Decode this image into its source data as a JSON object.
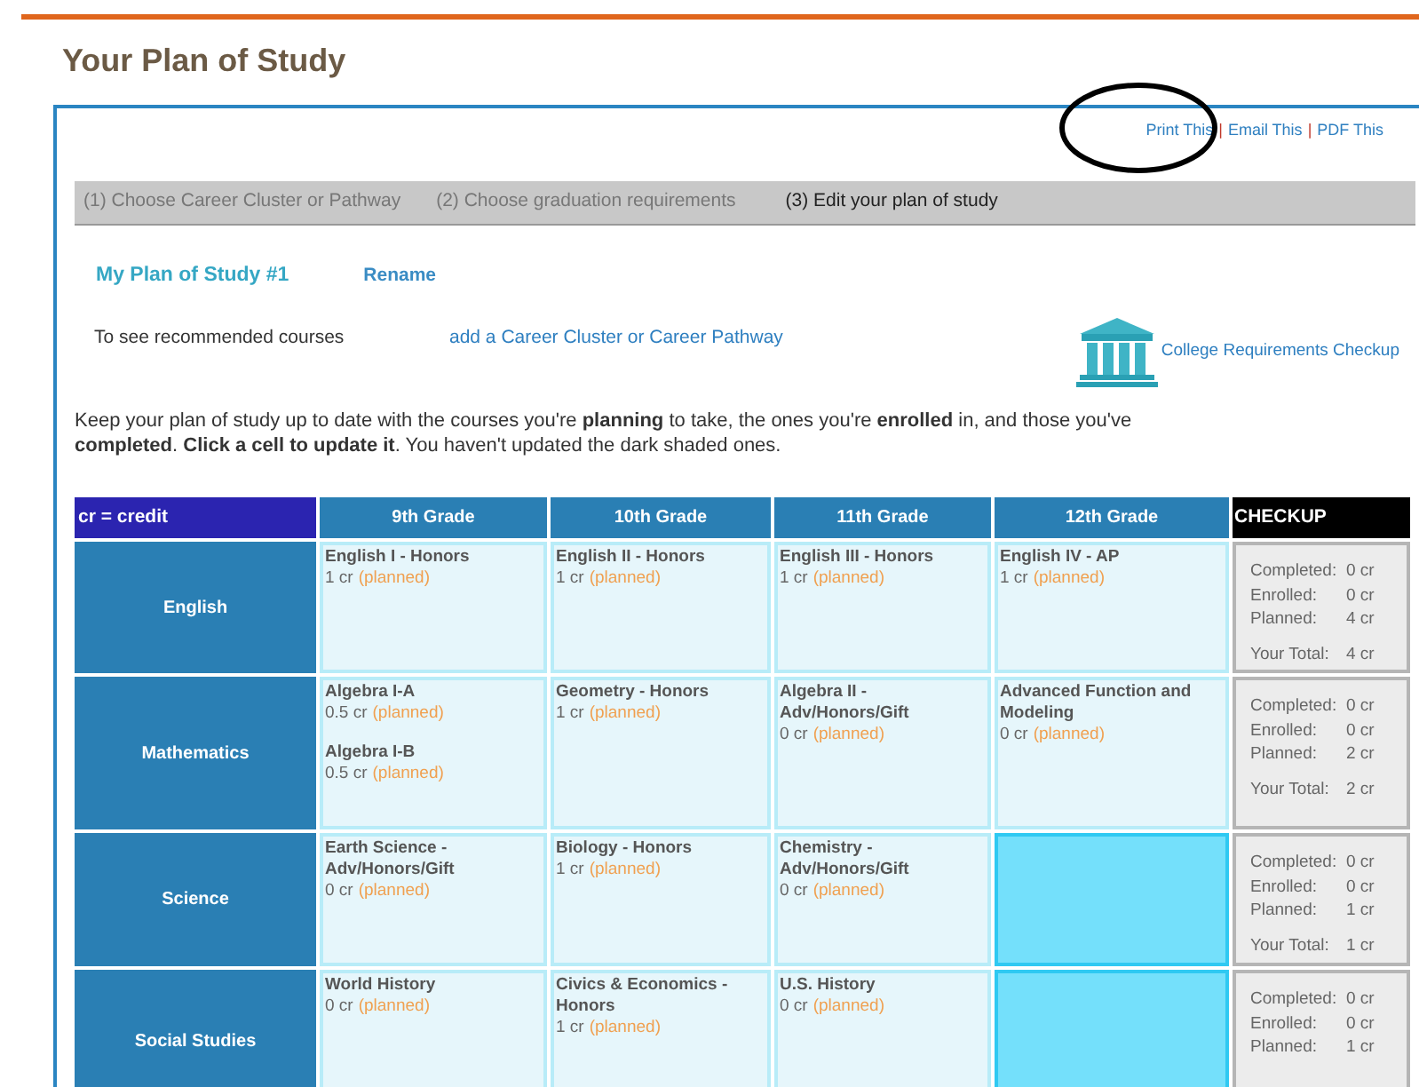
{
  "page_title": "Your Plan of Study",
  "share_links": [
    {
      "kind": "link",
      "label": "Print This"
    },
    {
      "kind": "separator",
      "label": "|"
    },
    {
      "kind": "link",
      "label": "Email This"
    },
    {
      "kind": "separator",
      "label": "|"
    },
    {
      "kind": "link",
      "label": "PDF This"
    }
  ],
  "steps": [
    {
      "label": "(1) Choose Career Cluster or Pathway",
      "selected": false
    },
    {
      "label": "(2) Choose graduation requirements",
      "selected": false
    },
    {
      "label": "(3) Edit your plan of study",
      "selected": true
    }
  ],
  "plan": {
    "name": "My Plan of Study #1",
    "rename": "Rename"
  },
  "recommend": {
    "text": "To see recommended courses",
    "link": "add a Career Cluster or Career Pathway"
  },
  "college_link": "College Requirements Checkup",
  "instructions": "Keep your plan of study up to date with the courses you're **planning** to take, the ones you're **enrolled** in, and those you've **completed**. **Click a cell to update it**. You haven't updated the dark shaded ones.",
  "table": {
    "corner": "cr = credit",
    "columns": [
      "9th Grade",
      "10th Grade",
      "11th Grade",
      "12th Grade"
    ],
    "checkup_heading": "CHECKUP",
    "rows": [
      {
        "subject": "English",
        "cells": [
          {
            "shaded": false,
            "courses": [
              {
                "name": "English I - Honors",
                "credits": "1 cr",
                "status": "(planned)"
              }
            ]
          },
          {
            "shaded": false,
            "courses": [
              {
                "name": "English II - Honors",
                "credits": "1 cr",
                "status": "(planned)"
              }
            ]
          },
          {
            "shaded": false,
            "courses": [
              {
                "name": "English III - Honors",
                "credits": "1 cr",
                "status": "(planned)"
              }
            ]
          },
          {
            "shaded": false,
            "courses": [
              {
                "name": "English IV - AP",
                "credits": "1 cr",
                "status": "(planned)"
              }
            ]
          }
        ],
        "checkup": [
          {
            "label": "Completed:",
            "value": "0 cr"
          },
          {
            "label": "Enrolled:",
            "value": "0 cr"
          },
          {
            "label": "Planned:",
            "value": "4 cr"
          }
        ],
        "total": {
          "label": "Your Total:",
          "value": "4 cr"
        }
      },
      {
        "subject": "Mathematics",
        "cells": [
          {
            "shaded": false,
            "courses": [
              {
                "name": "Algebra I-A",
                "credits": "0.5 cr",
                "status": "(planned)"
              },
              {
                "name": "Algebra I-B",
                "credits": "0.5 cr",
                "status": "(planned)"
              }
            ]
          },
          {
            "shaded": false,
            "courses": [
              {
                "name": "Geometry - Honors",
                "credits": "1 cr",
                "status": "(planned)"
              }
            ]
          },
          {
            "shaded": false,
            "courses": [
              {
                "name": "Algebra II - Adv/Honors/Gift",
                "credits": "0 cr",
                "status": "(planned)"
              }
            ]
          },
          {
            "shaded": false,
            "courses": [
              {
                "name": "Advanced Function and Modeling",
                "credits": "0 cr",
                "status": "(planned)"
              }
            ]
          }
        ],
        "checkup": [
          {
            "label": "Completed:",
            "value": "0 cr"
          },
          {
            "label": "Enrolled:",
            "value": "0 cr"
          },
          {
            "label": "Planned:",
            "value": "2 cr"
          }
        ],
        "total": {
          "label": "Your Total:",
          "value": "2 cr"
        }
      },
      {
        "subject": "Science",
        "cells": [
          {
            "shaded": false,
            "courses": [
              {
                "name": "Earth Science - Adv/Honors/Gift",
                "credits": "0 cr",
                "status": "(planned)"
              }
            ]
          },
          {
            "shaded": false,
            "courses": [
              {
                "name": "Biology - Honors",
                "credits": "1 cr",
                "status": "(planned)"
              }
            ]
          },
          {
            "shaded": false,
            "courses": [
              {
                "name": "Chemistry - Adv/Honors/Gift",
                "credits": "0 cr",
                "status": "(planned)"
              }
            ]
          },
          {
            "shaded": true
          }
        ],
        "checkup": [
          {
            "label": "Completed:",
            "value": "0 cr"
          },
          {
            "label": "Enrolled:",
            "value": "0 cr"
          },
          {
            "label": "Planned:",
            "value": "1 cr"
          }
        ],
        "total": {
          "label": "Your Total:",
          "value": "1 cr"
        }
      },
      {
        "subject": "Social Studies",
        "cells": [
          {
            "shaded": false,
            "courses": [
              {
                "name": "World History",
                "credits": "0 cr",
                "status": "(planned)"
              }
            ]
          },
          {
            "shaded": false,
            "courses": [
              {
                "name": "Civics & Economics - Honors",
                "credits": "1 cr",
                "status": "(planned)"
              }
            ]
          },
          {
            "shaded": false,
            "courses": [
              {
                "name": "U.S. History",
                "credits": "0 cr",
                "status": "(planned)"
              }
            ]
          },
          {
            "shaded": true
          }
        ],
        "checkup": [
          {
            "label": "Completed:",
            "value": "0 cr"
          },
          {
            "label": "Enrolled:",
            "value": "0 cr"
          },
          {
            "label": "Planned:",
            "value": "1 cr"
          }
        ]
      }
    ]
  }
}
